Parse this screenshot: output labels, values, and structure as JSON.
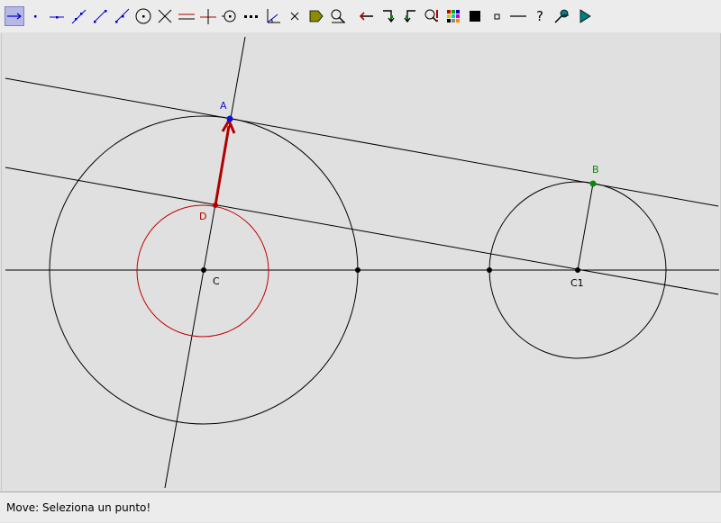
{
  "toolbar": {
    "tools": [
      {
        "name": "move-tool-icon",
        "active": true
      },
      {
        "name": "point-tool-icon"
      },
      {
        "name": "point-on-line-tool-icon"
      },
      {
        "name": "line-tool-icon"
      },
      {
        "name": "segment-tool-icon"
      },
      {
        "name": "ray-tool-icon"
      },
      {
        "name": "circle-center-point-tool-icon"
      },
      {
        "name": "intersect-tool-icon"
      },
      {
        "name": "parallel-line-tool-icon"
      },
      {
        "name": "perpendicular-line-tool-icon"
      },
      {
        "name": "circle-tool-icon"
      },
      {
        "name": "points-tool-icon"
      },
      {
        "name": "angle-tool-icon"
      },
      {
        "name": "delete-tool-icon"
      },
      {
        "name": "label-tool-icon"
      },
      {
        "name": "zoom-tool-icon"
      },
      {
        "name": "back-arrow-tool-icon"
      },
      {
        "name": "redo-tool-icon"
      },
      {
        "name": "undo-tool-icon"
      },
      {
        "name": "search-tool-icon"
      },
      {
        "name": "color-palette-tool-icon"
      },
      {
        "name": "fill-tool-icon"
      },
      {
        "name": "point-style-tool-icon"
      },
      {
        "name": "line-style-tool-icon"
      },
      {
        "name": "help-tool-icon"
      },
      {
        "name": "magnet-tool-icon"
      },
      {
        "name": "play-tool-icon"
      }
    ],
    "help_glyph": "?"
  },
  "canvas": {
    "labels": {
      "A": "A",
      "B": "B",
      "C": "C",
      "C1": "C1",
      "D": "D"
    },
    "colors": {
      "black": "#000000",
      "red": "#b00000",
      "circle_red": "#c00000",
      "blue": "#1010d0",
      "green": "#0a8a0a"
    }
  },
  "status": {
    "message": "Move: Seleziona un punto!"
  }
}
